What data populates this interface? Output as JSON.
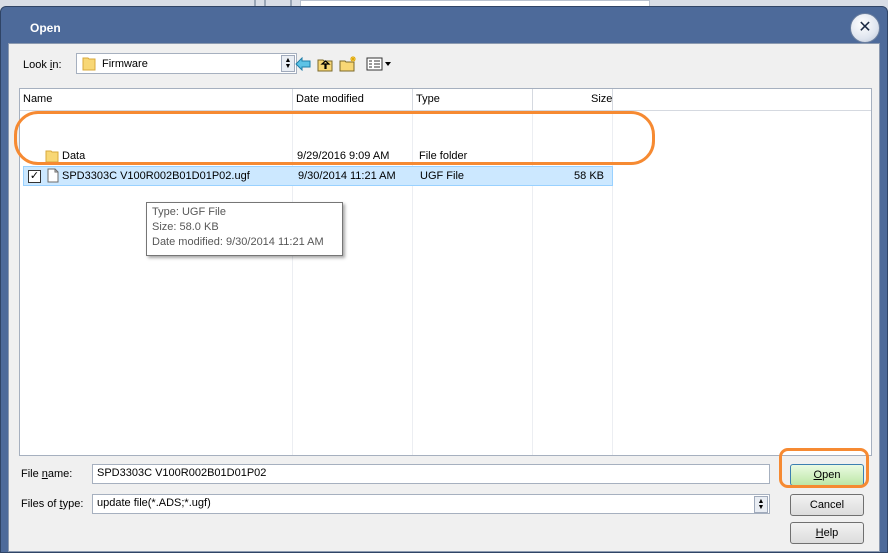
{
  "dialog": {
    "title": "Open"
  },
  "lookin": {
    "label_pre": "Look ",
    "label_key": "i",
    "label_post": "n:",
    "value": "Firmware"
  },
  "columns": {
    "name": "Name",
    "date": "Date modified",
    "type": "Type",
    "size": "Size"
  },
  "rows": [
    {
      "name": "Data",
      "date": "9/29/2016 9:09 AM",
      "type": "File folder",
      "size": ""
    },
    {
      "name": "SPD3303C V100R002B01D01P02.ugf",
      "date": "9/30/2014 11:21 AM",
      "type": "UGF File",
      "size": "58 KB"
    }
  ],
  "tooltip": {
    "type": "Type: UGF File",
    "size": "Size: 58.0 KB",
    "modified": "Date modified: 9/30/2014 11:21 AM"
  },
  "filename": {
    "label_pre": "File ",
    "label_key": "n",
    "label_post": "ame:",
    "value": "SPD3303C V100R002B01D01P02"
  },
  "filetype": {
    "label_pre": "Files of ",
    "label_key": "t",
    "label_post": "ype:",
    "value": "update file(*.ADS;*.ugf)"
  },
  "buttons": {
    "open_key": "O",
    "open_rest": "pen",
    "cancel": "Cancel",
    "help_key": "H",
    "help_rest": "elp"
  },
  "colors": {
    "annotation": "#f68a32",
    "selection": "#cce8ff",
    "title_bar": "#4d6a9a"
  }
}
